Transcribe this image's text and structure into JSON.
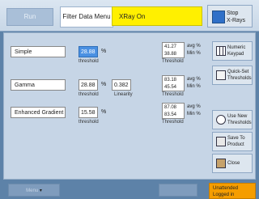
{
  "header": {
    "run_label": "Run",
    "screen_title": "Filter Data Menu",
    "status_text": "XRay On",
    "stop_label_line1": "Stop",
    "stop_label_line2": "X-Rays"
  },
  "filters": [
    {
      "name": "Simple",
      "threshold": "28.88",
      "threshold_caption": "threshold",
      "result_line1": "41.27",
      "result_line2": "38.88",
      "unit_line1": "avg %",
      "unit_line2": "Min %",
      "result_caption": "Threshold"
    },
    {
      "name": "Gamma",
      "threshold": "28.88",
      "threshold_caption": "threshold",
      "extra_value": "0.382",
      "extra_caption": "Linearity",
      "result_line1": "83.18",
      "result_line2": "45.54",
      "unit_line1": "avg %",
      "unit_line2": "Min %",
      "result_caption": "Threshold"
    },
    {
      "name": "Enhanced Gradient",
      "threshold": "15.58",
      "threshold_caption": "threshold",
      "result_line1": "87.08",
      "result_line2": "83.54",
      "unit_line1": "avg %",
      "unit_line2": "Min %",
      "result_caption": "Threshold"
    }
  ],
  "percent_sign": "%",
  "sidebar": {
    "numeric_keypad": {
      "line1": "Numeric",
      "line2": "Keypad",
      "icon": "keypad-icon"
    },
    "quick_set": {
      "line1": "Quick-Set",
      "line2": "Thresholds",
      "icon": "pencil-icon"
    },
    "use_new": {
      "line1": "Use New",
      "line2": "Thresholds",
      "icon": "refresh-icon"
    },
    "save_to_product": {
      "line1": "Save To",
      "line2": "Product",
      "icon": "save-icon"
    },
    "close": {
      "line1": "Close",
      "icon": "door-icon"
    }
  },
  "footer": {
    "left_button": "Menu",
    "middle_button": "",
    "user_line1": "Unattended",
    "user_line2": "Logged in"
  }
}
